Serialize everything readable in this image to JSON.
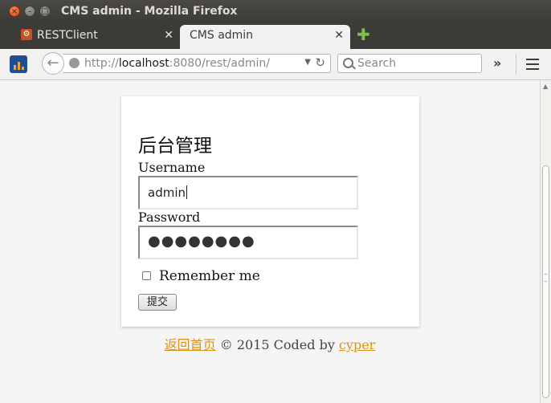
{
  "window": {
    "title": "CMS admin - Mozilla Firefox"
  },
  "tabs": [
    {
      "label": "RESTClient",
      "active": false
    },
    {
      "label": "CMS admin",
      "active": true
    }
  ],
  "toolbar": {
    "url_prefix": "http://",
    "url_host": "localhost",
    "url_rest": ":8080/rest/admin/",
    "search_placeholder": "Search"
  },
  "login": {
    "title": "后台管理",
    "username_label": "Username",
    "username_value": "admin",
    "password_label": "Password",
    "password_masked": "●●●●●●●●",
    "remember_label": "Remember me",
    "remember_checked": false,
    "submit_label": "提交"
  },
  "footer": {
    "home_link": "返回首页",
    "text": "© 2015 Coded by",
    "author_link": "cyper"
  },
  "colors": {
    "link": "#d9921a",
    "titlebar": "#3c3b37"
  }
}
